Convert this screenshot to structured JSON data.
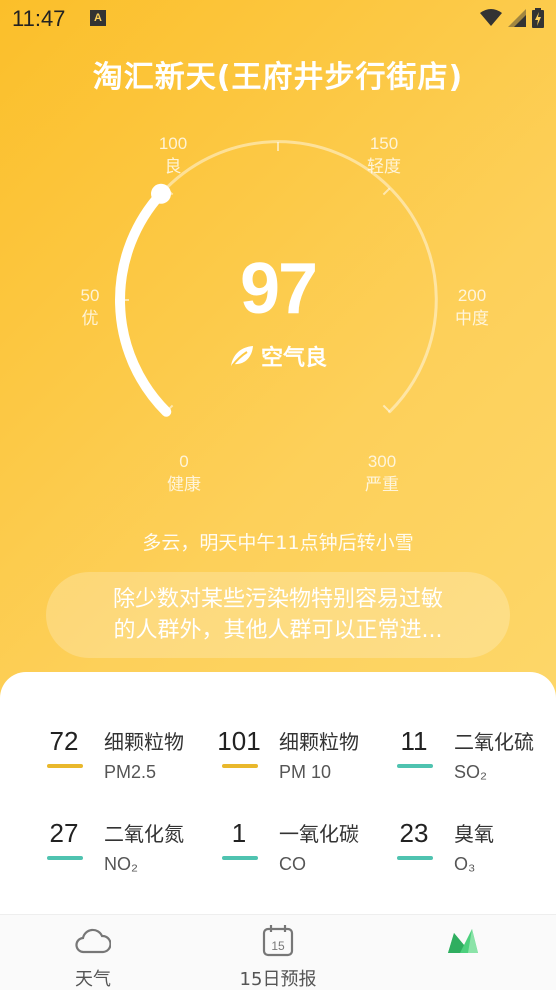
{
  "status_bar": {
    "time": "11:47",
    "a_badge": "A"
  },
  "store_title": "淘汇新天(王府井步行街店)",
  "gauge": {
    "labels": [
      {
        "value": "0",
        "text": "健康"
      },
      {
        "value": "50",
        "text": "优"
      },
      {
        "value": "100",
        "text": "良"
      },
      {
        "value": "150",
        "text": "轻度"
      },
      {
        "value": "200",
        "text": "中度"
      },
      {
        "value": "300",
        "text": "严重"
      }
    ]
  },
  "aqi": {
    "value": "97",
    "level": "空气良",
    "fraction": 0.323
  },
  "forecast": "多云，明天中午11点钟后转小雪",
  "advice": {
    "line1": "除少数对某些污染物特别容易过敏",
    "line2": "的人群外，其他人群可以正常进..."
  },
  "pollutants": [
    {
      "value": "72",
      "name": "细颗粒物",
      "code": "PM2.5",
      "color": "#e9b82c"
    },
    {
      "value": "101",
      "name": "细颗粒物",
      "code": "PM 10",
      "color": "#e9b82c"
    },
    {
      "value": "11",
      "name": "二氧化硫",
      "code": "SO₂",
      "color": "#4fc3b0"
    },
    {
      "value": "27",
      "name": "二氧化氮",
      "code": "NO₂",
      "color": "#4fc3b0"
    },
    {
      "value": "1",
      "name": "一氧化碳",
      "code": "CO",
      "color": "#4fc3b0"
    },
    {
      "value": "23",
      "name": "臭氧",
      "code": "O₃",
      "color": "#4fc3b0"
    }
  ],
  "nav": [
    {
      "label": "天气",
      "icon": "cloud-icon"
    },
    {
      "label": "15日预报",
      "icon": "calendar-icon",
      "badge": "15"
    },
    {
      "label": "",
      "icon": "air-quality-icon"
    }
  ]
}
